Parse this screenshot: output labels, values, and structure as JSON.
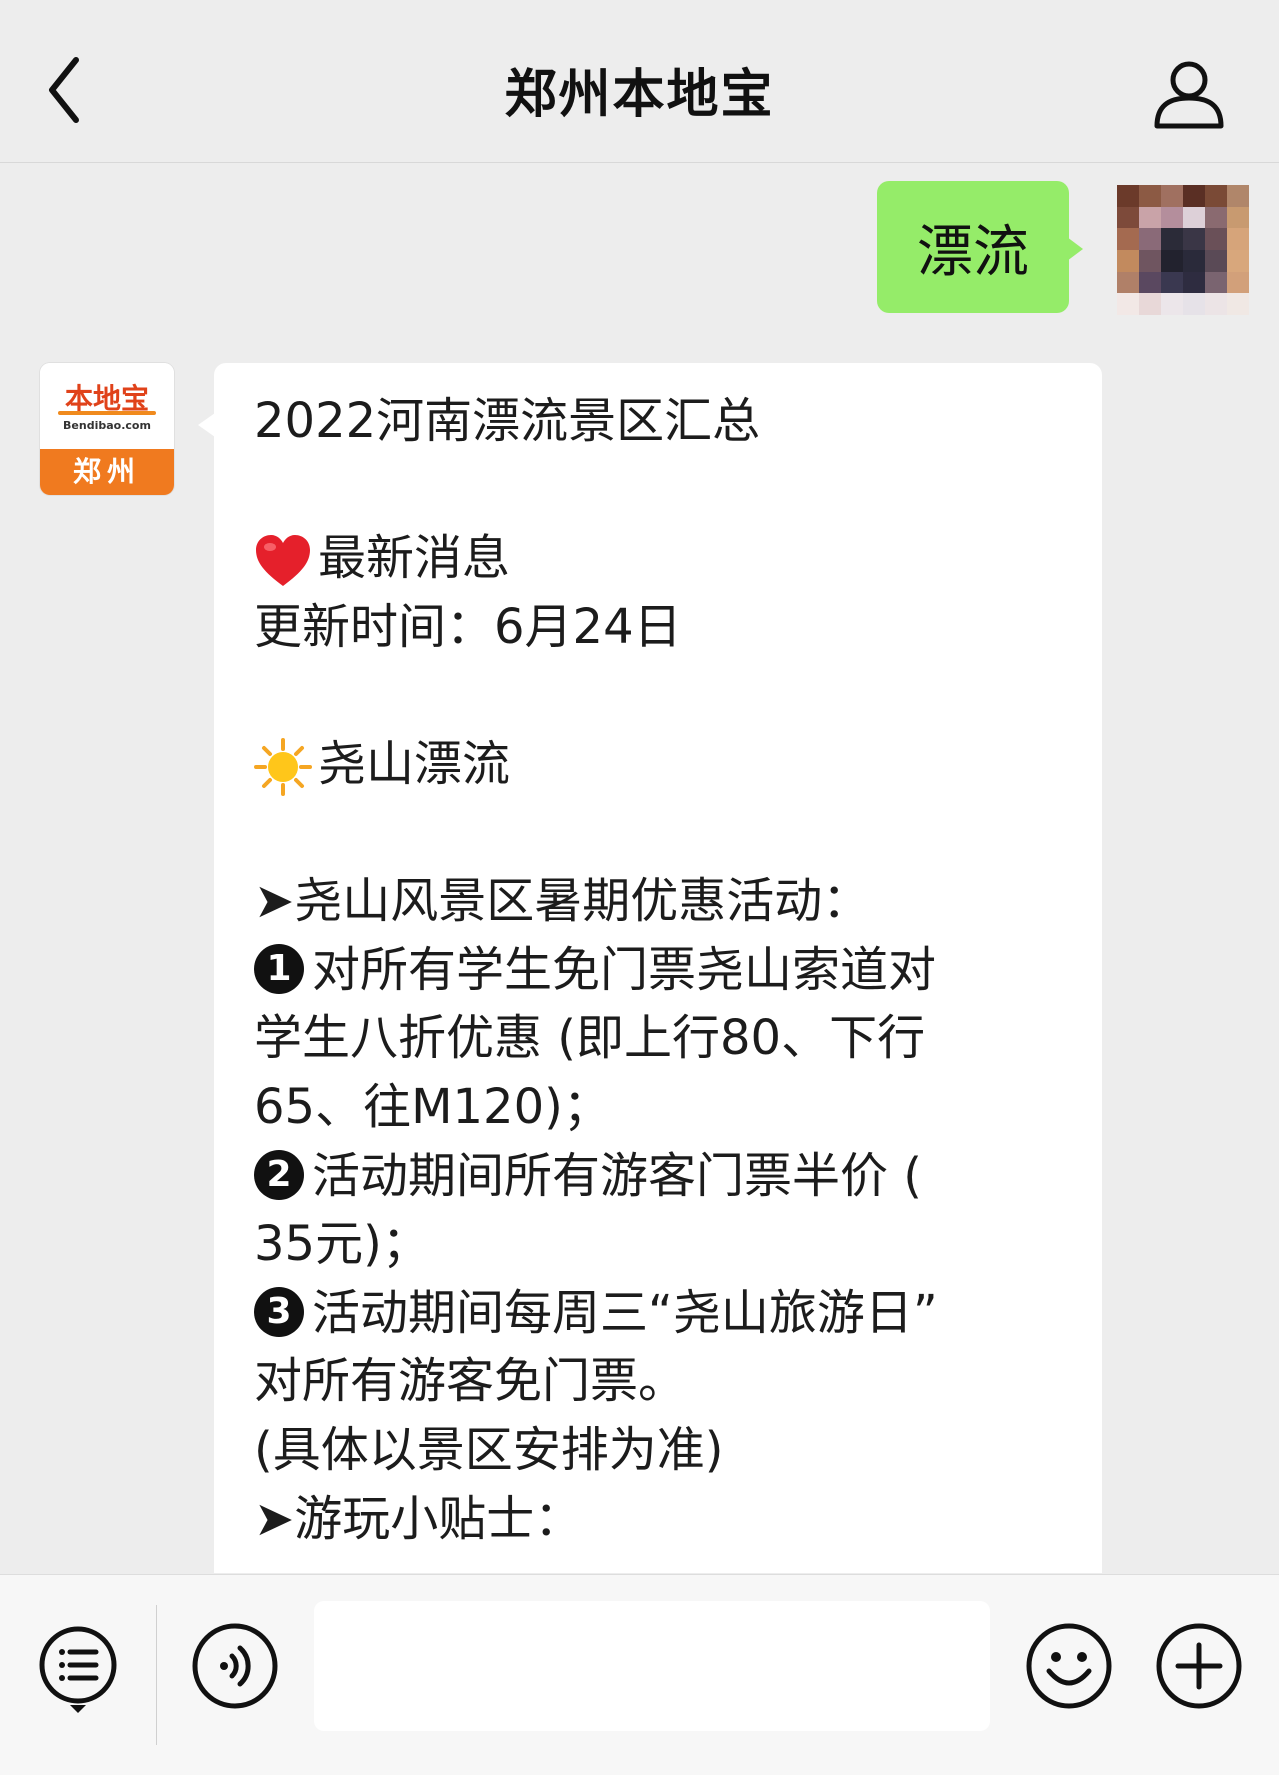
{
  "header": {
    "title": "郑州本地宝",
    "back_icon": "chevron-left-icon",
    "profile_icon": "person-icon"
  },
  "outgoing_message": {
    "text": "漂流",
    "bubble_color": "#95ec69"
  },
  "incoming_account": {
    "logo_text": "本地宝",
    "logo_domain": "Bendibao.com",
    "logo_city": "郑州",
    "logo_color": "#f07a1f"
  },
  "incoming_message": {
    "lines": {
      "l1": "2022河南漂流景区汇总",
      "l2": "最新消息",
      "l3": "更新时间：6月24日",
      "l4": "尧山漂流",
      "l5": "➤尧山风景区暑期优惠活动：",
      "l6_num": "1",
      "l6": "对所有学生免门票尧山索道对",
      "l7": "学生八折优惠 (即上行80、下行",
      "l8": "65、往M120)；",
      "l9_num": "2",
      "l9": "活动期间所有游客门票半价 (",
      "l10": "35元)；",
      "l11_num": "3",
      "l11": "活动期间每周三“尧山旅游日”",
      "l12": "对所有游客免门票。",
      "l13": " (具体以景区安排为准)",
      "l14": "➤游玩小贴士："
    },
    "icons": [
      "heart-icon",
      "sun-icon"
    ]
  },
  "input_bar": {
    "menu_icon": "list-menu-icon",
    "voice_icon": "voice-icon",
    "input_value": "",
    "emoji_icon": "smiley-icon",
    "plus_icon": "plus-icon"
  }
}
